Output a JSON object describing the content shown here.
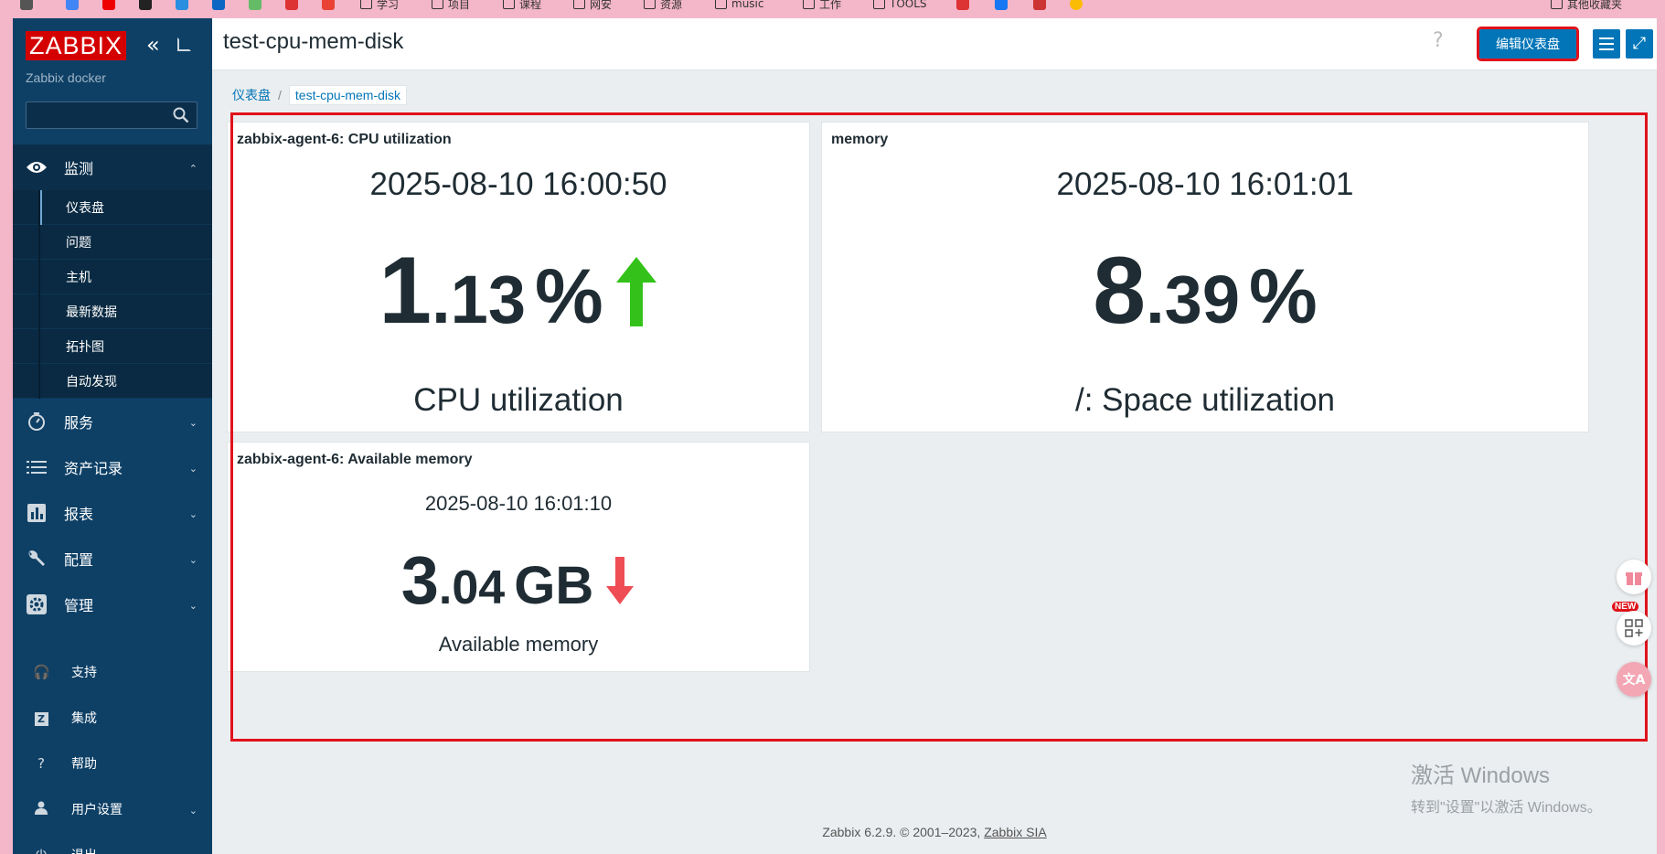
{
  "bookmarks": [
    "学习",
    "项目",
    "课程",
    "网安",
    "资源",
    "music",
    "工作",
    "TOOLS",
    "其他收藏夹"
  ],
  "sidebar": {
    "logo": "ZABBIX",
    "server_name": "Zabbix docker",
    "search_value": "",
    "groups": [
      {
        "label": "监测",
        "icon": "eye-icon",
        "expanded": true,
        "items": [
          "仪表盘",
          "问题",
          "主机",
          "最新数据",
          "拓扑图",
          "自动发现"
        ],
        "selected": "仪表盘"
      },
      {
        "label": "服务",
        "icon": "stopwatch-icon"
      },
      {
        "label": "资产记录",
        "icon": "list-icon"
      },
      {
        "label": "报表",
        "icon": "bar-chart-icon"
      },
      {
        "label": "配置",
        "icon": "wrench-icon"
      },
      {
        "label": "管理",
        "icon": "gear-icon"
      }
    ],
    "bottom": [
      {
        "label": "支持",
        "icon": "headset-icon"
      },
      {
        "label": "集成",
        "icon": "zabbix-z-icon"
      },
      {
        "label": "帮助",
        "icon": "question-icon"
      },
      {
        "label": "用户设置",
        "icon": "user-icon"
      },
      {
        "label": "退出",
        "icon": "power-icon"
      }
    ]
  },
  "header": {
    "title": "test-cpu-mem-disk",
    "edit_button": "编辑仪表盘"
  },
  "breadcrumb": {
    "root": "仪表盘",
    "current": "test-cpu-mem-disk"
  },
  "widgets": [
    {
      "title": "zabbix-agent-6: CPU utilization",
      "time": "2025-08-10 16:00:50",
      "value_int": "1",
      "value_dec": ".13",
      "unit": "%",
      "trend": "up",
      "trend_color": "#34c21a",
      "description": "CPU utilization"
    },
    {
      "title": "memory",
      "time": "2025-08-10 16:01:01",
      "value_int": "8",
      "value_dec": ".39",
      "unit": "%",
      "trend": "none",
      "description": "/: Space utilization"
    },
    {
      "title": "zabbix-agent-6: Available memory",
      "time": "2025-08-10 16:01:10",
      "value_int": "3",
      "value_dec": ".04",
      "unit": "GB",
      "trend": "down",
      "trend_color": "#ef4d56",
      "description": "Available memory"
    }
  ],
  "footer": {
    "text": "Zabbix 6.2.9. © 2001–2023, ",
    "link": "Zabbix SIA"
  },
  "watermark": {
    "line1": "激活 Windows",
    "line2": "转到\"设置\"以激活 Windows。"
  },
  "floating_badge": "NEW",
  "colors": {
    "sidebar_bg": "#0e4066",
    "accent": "#0275b8",
    "highlight_red": "#e0121b"
  }
}
